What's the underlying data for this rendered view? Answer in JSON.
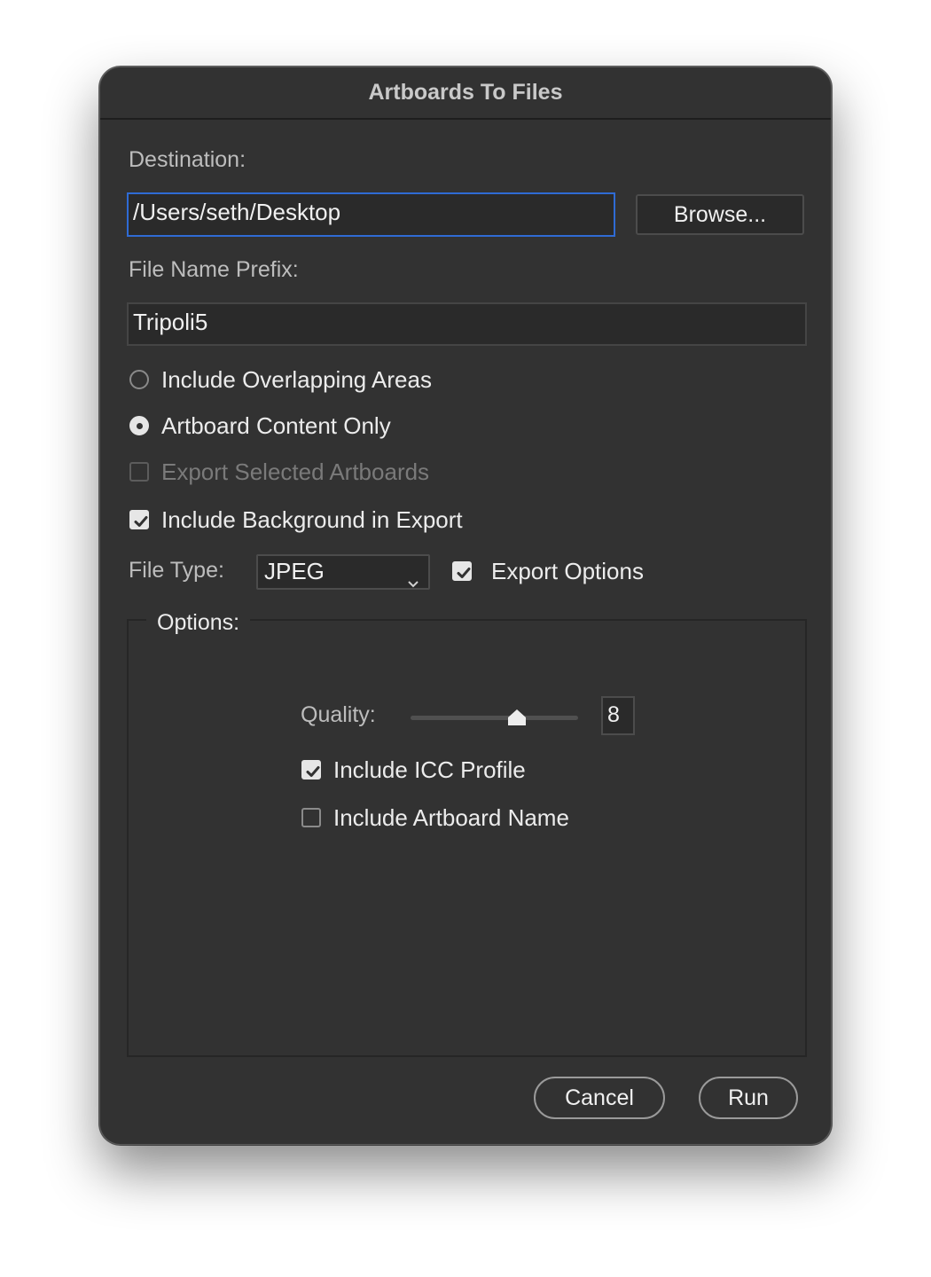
{
  "dialog": {
    "title": "Artboards To Files",
    "destination_label": "Destination:",
    "destination_value": "/Users/seth/Desktop",
    "browse_label": "Browse...",
    "prefix_label": "File Name Prefix:",
    "prefix_value": "Tripoli5",
    "radio_overlapping": {
      "label": "Include Overlapping Areas",
      "selected": false
    },
    "radio_content_only": {
      "label": "Artboard Content Only",
      "selected": true
    },
    "check_selected_artboards": {
      "label": "Export Selected Artboards",
      "checked": false,
      "enabled": false
    },
    "check_background": {
      "label": "Include Background in Export",
      "checked": true
    },
    "file_type_label": "File Type:",
    "file_type_value": "JPEG",
    "check_export_options": {
      "label": "Export Options",
      "checked": true
    },
    "options_title": "Options:",
    "quality_label": "Quality:",
    "quality_value": "8",
    "check_icc": {
      "label": "Include ICC Profile",
      "checked": true
    },
    "check_artboard_name": {
      "label": "Include Artboard Name",
      "checked": false
    },
    "cancel_label": "Cancel",
    "run_label": "Run"
  },
  "colors": {
    "dialog_bg": "#323232",
    "focus_border": "#2f6bd4",
    "field_bg": "#2a2a2a"
  }
}
